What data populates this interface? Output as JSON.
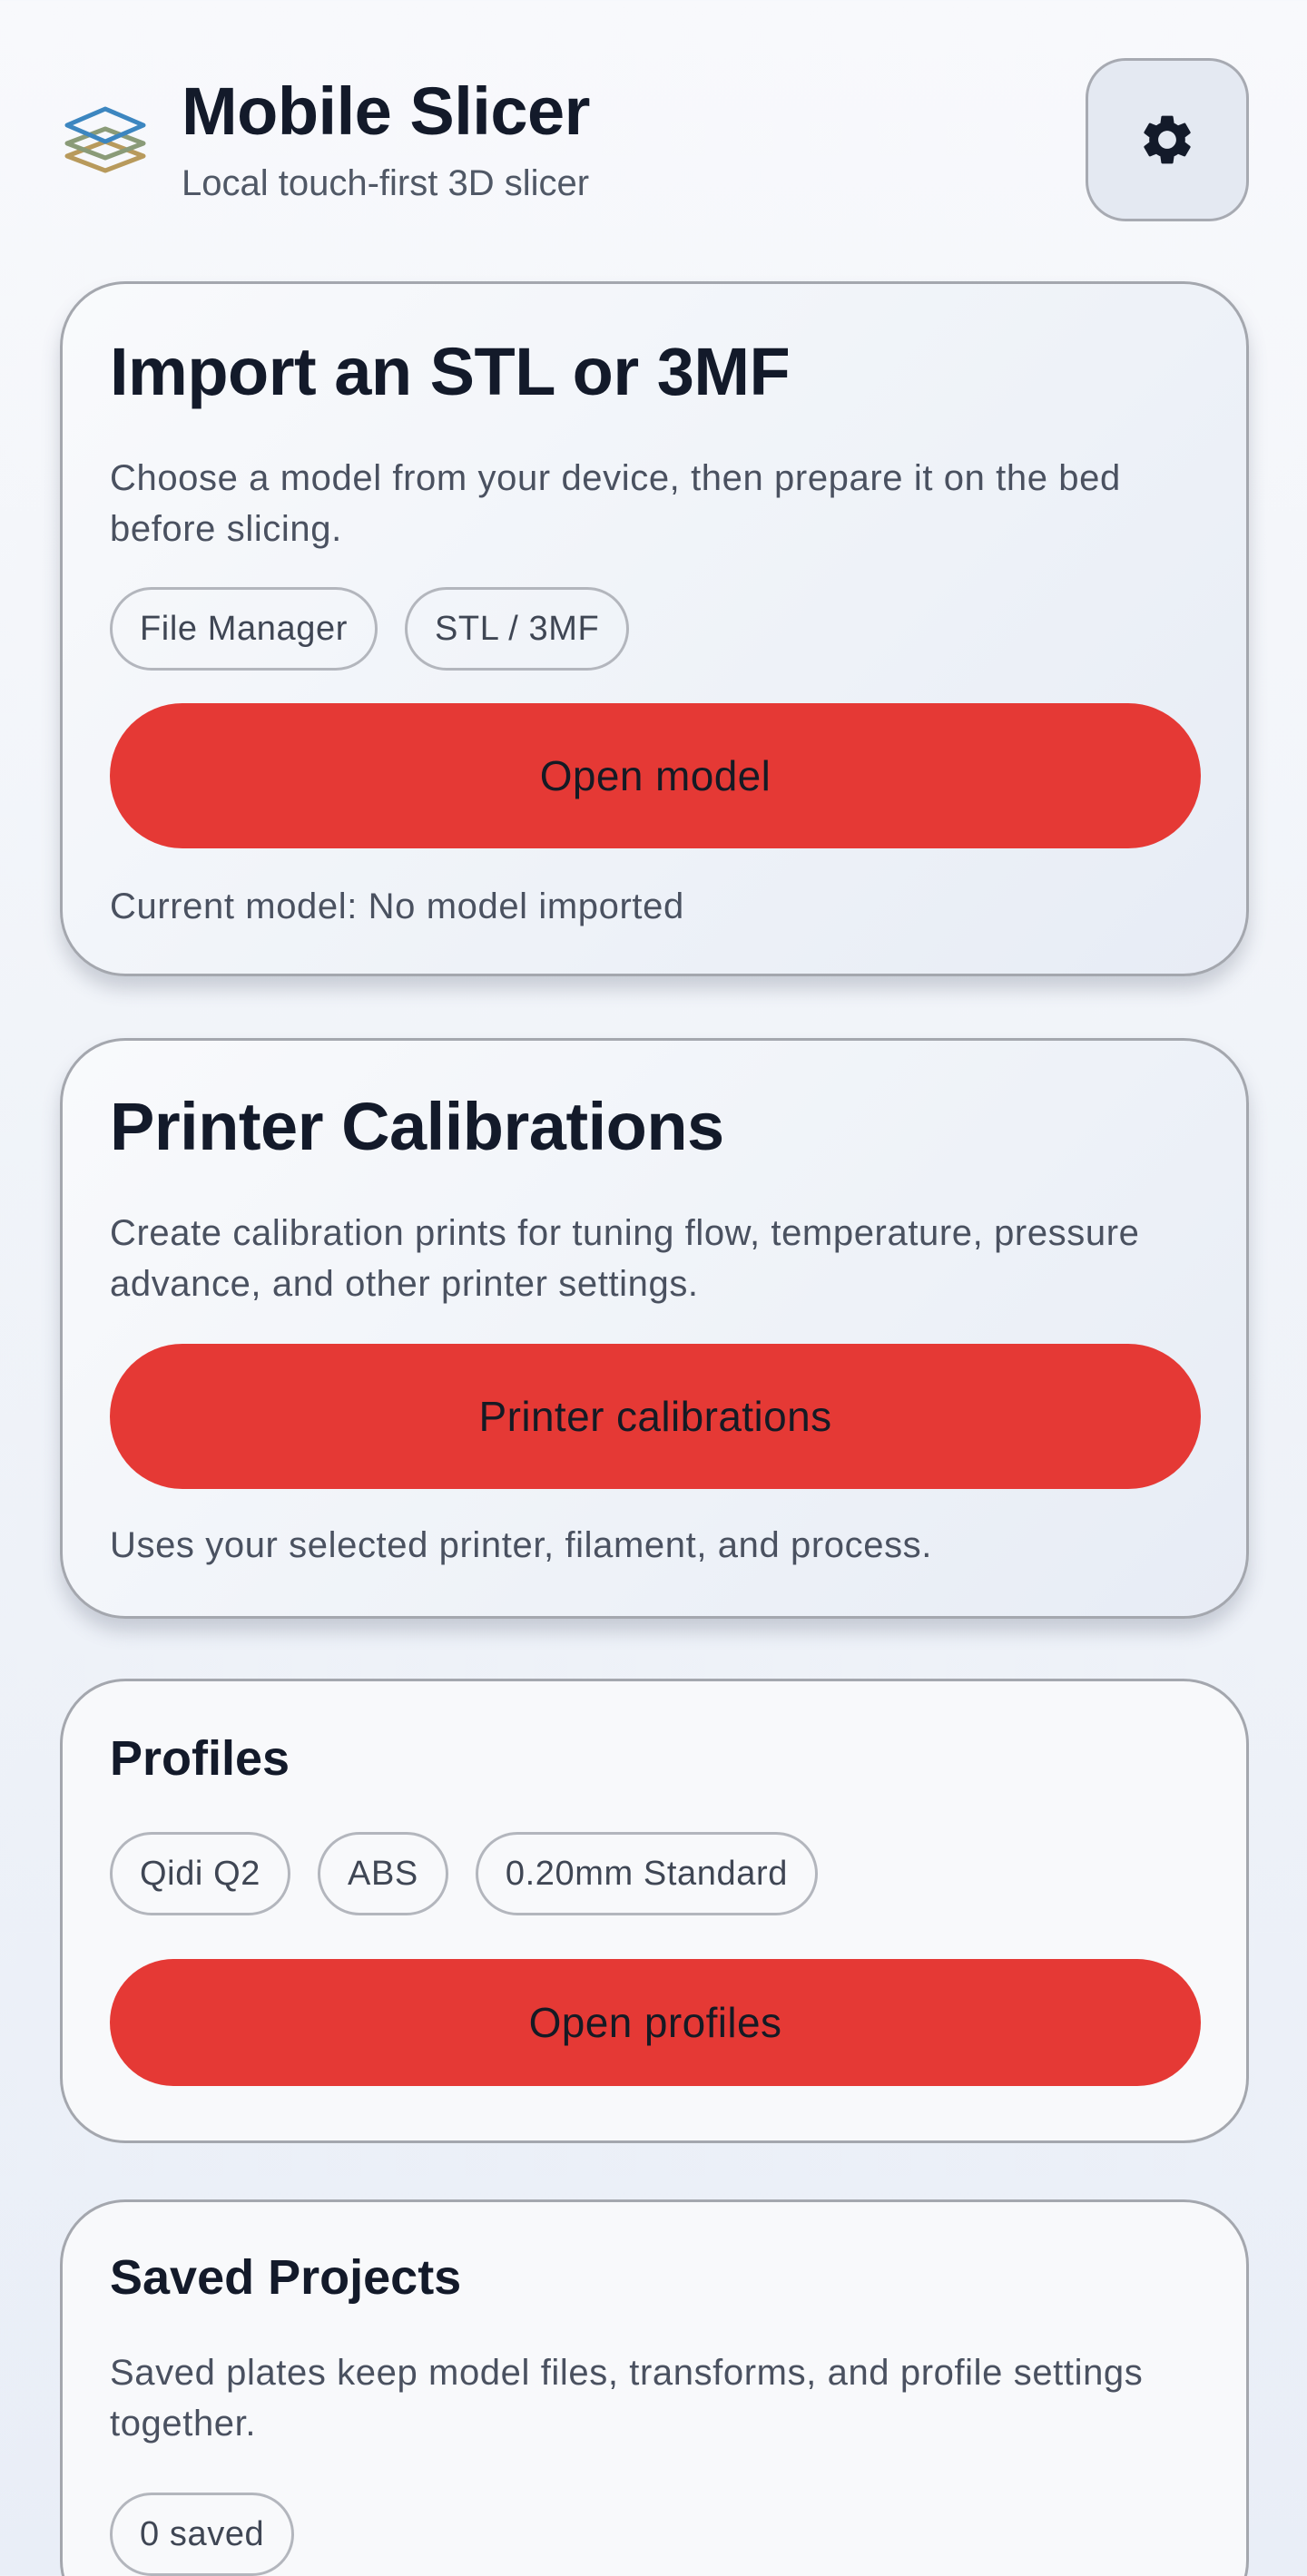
{
  "header": {
    "title": "Mobile Slicer",
    "subtitle": "Local touch-first 3D slicer",
    "logo_icon": "layers-icon",
    "settings_icon": "gear-icon"
  },
  "import_card": {
    "title": "Import an STL or 3MF",
    "description": "Choose a model from your device, then prepare it on the bed before slicing.",
    "chips": [
      "File Manager",
      "STL / 3MF"
    ],
    "button_label": "Open model",
    "status": "Current model: No model imported"
  },
  "calibration_card": {
    "title": "Printer Calibrations",
    "description": "Create calibration prints for tuning flow, temperature, pressure advance, and other printer settings.",
    "button_label": "Printer calibrations",
    "note": "Uses your selected printer, filament, and process."
  },
  "profiles_card": {
    "title": "Profiles",
    "chips": [
      "Qidi Q2",
      "ABS",
      "0.20mm Standard"
    ],
    "button_label": "Open profiles"
  },
  "projects_card": {
    "title": "Saved Projects",
    "description": "Saved plates keep model files, transforms, and profile settings together.",
    "chips": [
      "0 saved"
    ]
  },
  "colors": {
    "accent": "#e53935",
    "title_text": "#131a2a",
    "body_text": "#4a5160",
    "border": "#a4a7ae"
  }
}
